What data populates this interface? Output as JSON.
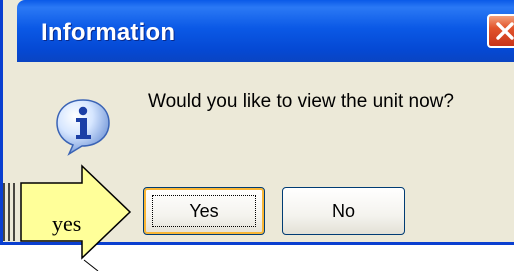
{
  "window": {
    "title": "Information",
    "close_icon": "close-icon"
  },
  "dialog": {
    "icon": "info-icon",
    "message": "Would you like to view the unit now?"
  },
  "buttons": {
    "yes_label": "Yes",
    "no_label": "No"
  },
  "annotation": {
    "text": "yes",
    "arrow_color": "#ffff99",
    "arrow_border": "#000000"
  },
  "colors": {
    "titlebar": "#0b59e6",
    "close_button": "#e2542b",
    "dialog_background": "#ece9d8",
    "default_button_highlight": "#f8b636"
  }
}
